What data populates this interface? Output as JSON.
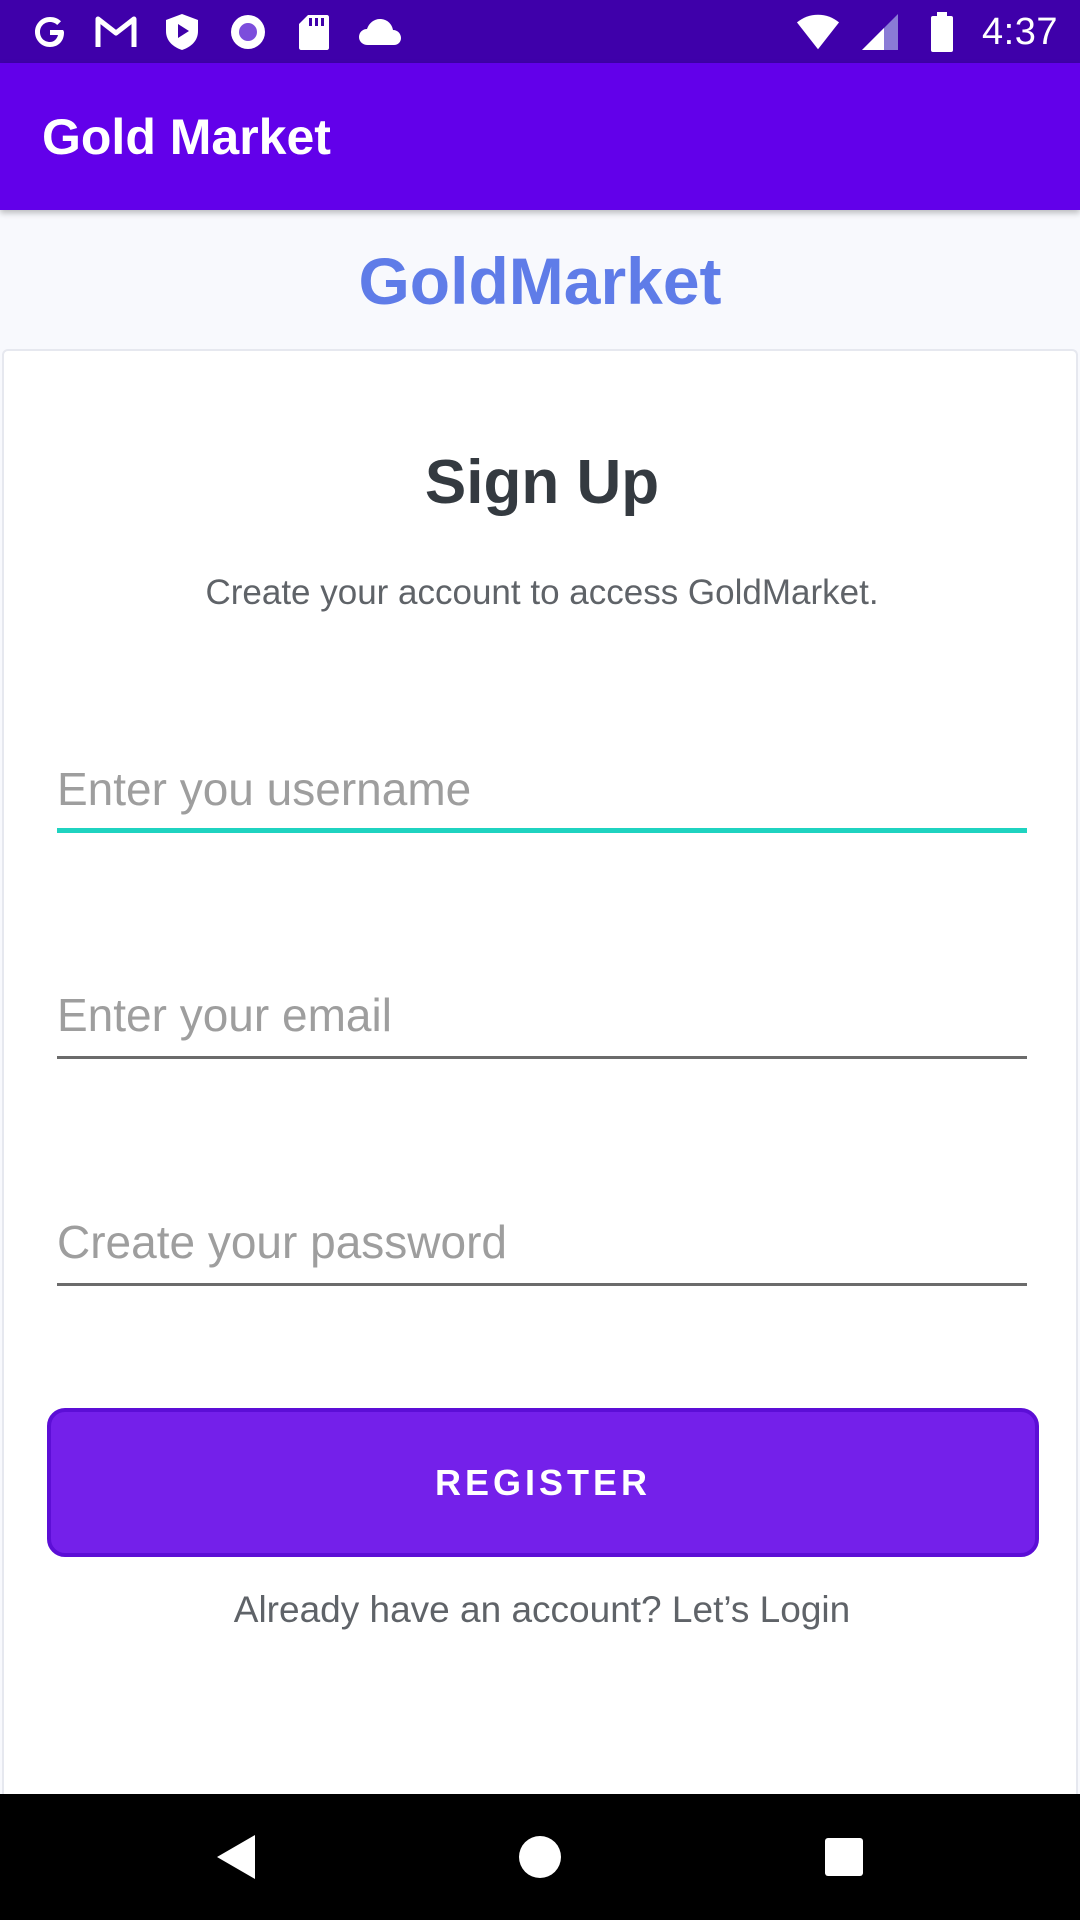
{
  "status_bar": {
    "time": "4:37",
    "left_icons": [
      "google-icon",
      "gmail-icon",
      "play-shield-icon",
      "circle-app-icon",
      "sd-card-icon",
      "cloud-icon"
    ],
    "right_icons": [
      "wifi-icon",
      "signal-icon",
      "battery-icon"
    ]
  },
  "app_bar": {
    "title": "Gold Market"
  },
  "brand": {
    "name": "GoldMarket"
  },
  "signup": {
    "title": "Sign Up",
    "subtitle": "Create your account to access GoldMarket.",
    "username": {
      "placeholder": "Enter you username",
      "value": ""
    },
    "email": {
      "placeholder": "Enter your email",
      "value": ""
    },
    "password": {
      "placeholder": "Create your password",
      "value": ""
    },
    "register_label": "REGISTER",
    "login_prompt": "Already have an account? Let’s Login"
  },
  "nav_bar": {
    "buttons": [
      "back-icon",
      "home-icon",
      "recents-icon"
    ]
  },
  "colors": {
    "status_bar": "#3f00aa",
    "app_bar": "#6200ea",
    "brand": "#5f7ce8",
    "button": "#7420ea",
    "focus_underline": "#1fd3c0"
  }
}
